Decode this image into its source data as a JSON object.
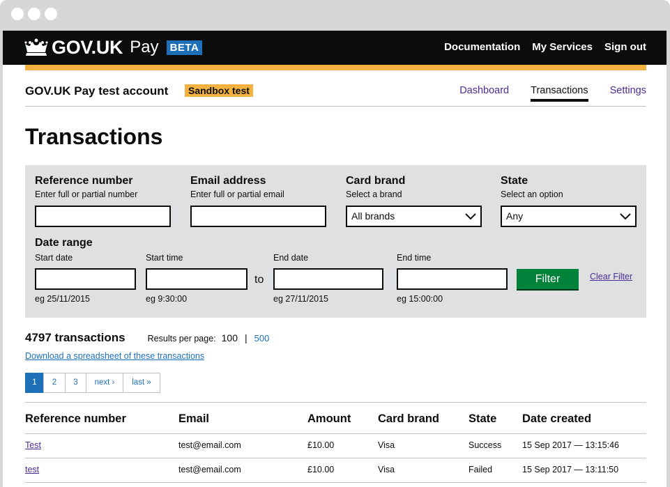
{
  "colors": {
    "header_bg": "#0b0c0c",
    "accent_yellow": "#f3b23f",
    "beta_blue": "#1d70b8",
    "filter_button": "#00823b",
    "link_purple": "#4c2c92",
    "link_blue": "#1d70b8",
    "filter_panel": "#dee0e2"
  },
  "header": {
    "logo_icon": "crown-icon",
    "logo_text": "GOV.UK",
    "product": "Pay",
    "phase": "BETA",
    "nav": [
      "Documentation",
      "My Services",
      "Sign out"
    ]
  },
  "account": {
    "name": "GOV.UK Pay test account",
    "badge": "Sandbox test",
    "tabs": [
      "Dashboard",
      "Transactions",
      "Settings"
    ],
    "active_tab": "Transactions"
  },
  "page": {
    "title": "Transactions"
  },
  "filters": {
    "reference": {
      "label": "Reference number",
      "hint": "Enter full or partial number",
      "value": ""
    },
    "email": {
      "label": "Email address",
      "hint": "Enter full or partial email",
      "value": ""
    },
    "card_brand": {
      "label": "Card brand",
      "hint": "Select a brand",
      "value": "All brands"
    },
    "state": {
      "label": "State",
      "hint": "Select an option",
      "value": "Any"
    },
    "date_range": {
      "label": "Date range",
      "start_date": {
        "label": "Start date",
        "example": "eg 25/11/2015"
      },
      "start_time": {
        "label": "Start time",
        "example": "eg 9:30:00"
      },
      "separator": "to",
      "end_date": {
        "label": "End date",
        "example": "eg 27/11/2015"
      },
      "end_time": {
        "label": "End time",
        "example": "eg 15:00:00"
      }
    },
    "filter_button": "Filter",
    "clear_link": "Clear Filter"
  },
  "results": {
    "count": "4797 transactions",
    "per_page_label": "Results per page:",
    "per_page_current": "100",
    "separator": "|",
    "per_page_other": "500",
    "download_link": "Download a spreadsheet of these transactions"
  },
  "pagination": [
    "1",
    "2",
    "3",
    "next ›",
    "last »"
  ],
  "table": {
    "headers": [
      "Reference number",
      "Email",
      "Amount",
      "Card brand",
      "State",
      "Date created"
    ],
    "rows": [
      [
        "Test",
        "test@email.com",
        "£10.00",
        "Visa",
        "Success",
        "15 Sep 2017 — 13:15:46"
      ],
      [
        "test",
        "test@email.com",
        "£10.00",
        "Visa",
        "Failed",
        "15 Sep 2017 — 13:11:50"
      ]
    ]
  }
}
